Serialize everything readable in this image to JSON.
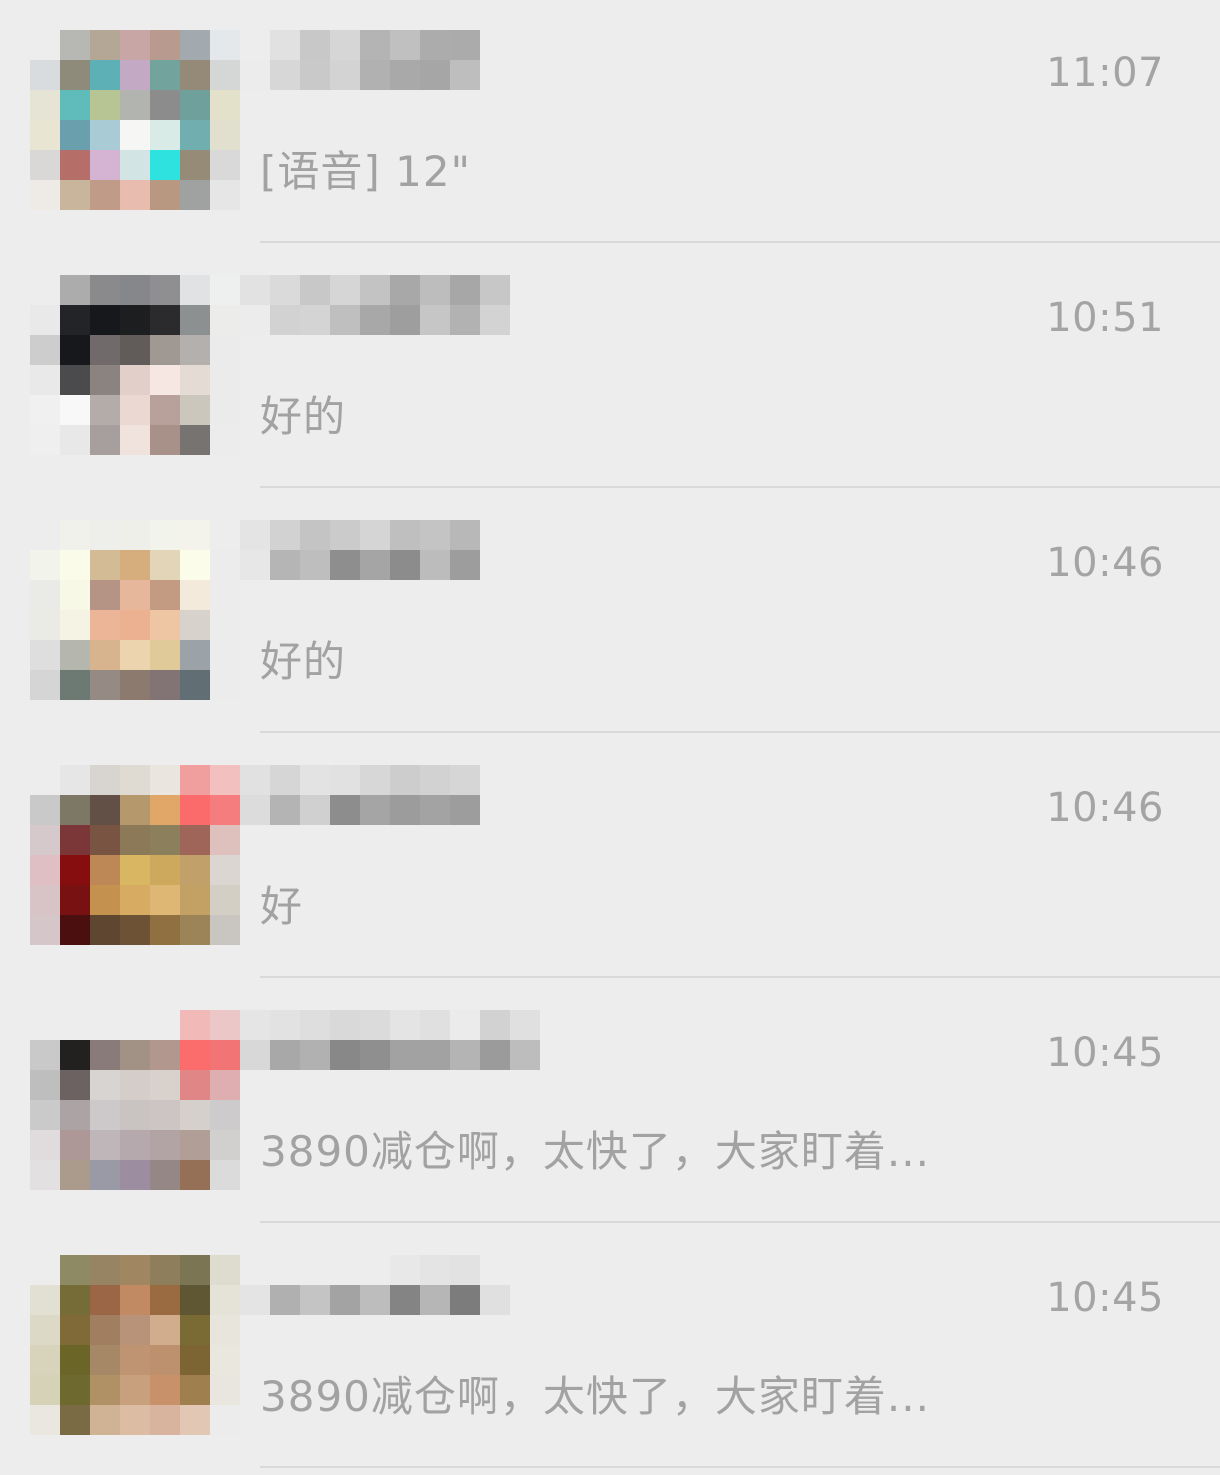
{
  "chats": [
    {
      "time": "11:07",
      "preview": "[语音] 12\"",
      "avatar_pixels": [
        "#ededed",
        "#b7b8b4",
        "#b5a795",
        "#c9a6a6",
        "#b89a8f",
        "#a3aaaf",
        "#e5e8ea",
        "#d9dcde",
        "#8f8b7a",
        "#5eb0b7",
        "#c4a9c5",
        "#72a49d",
        "#948a77",
        "#d5d7d7",
        "#e6e5d5",
        "#60bcbb",
        "#b7c594",
        "#b2b4b0",
        "#8c8c8c",
        "#6fa09b",
        "#e3e1ca",
        "#e8e6d3",
        "#6a9fad",
        "#a9cbd6",
        "#f6f6f4",
        "#d8ebe6",
        "#70aeb0",
        "#e1dfcd",
        "#d9d8d6",
        "#b56f68",
        "#d5b3d3",
        "#d3e4e5",
        "#2ee2e0",
        "#968b77",
        "#d9d9d9",
        "#eeebe6",
        "#c8b59c",
        "#c09b88",
        "#e8bcae",
        "#b89880",
        "#9fa2a1",
        "#e6e6e6"
      ],
      "name_pixels": [
        "#ededed",
        "#ececec",
        "#e1e1e1",
        "#d7d7d7",
        "#c8c8c8",
        "#c9c9c9",
        "#d6d6d6",
        "#d3d3d3",
        "#b4b4b4",
        "#b1b1b1",
        "#c0c0c0",
        "#a9a9a9",
        "#acacac",
        "#a6a6a6",
        "#ababab",
        "#bebebe"
      ]
    },
    {
      "time": "10:51",
      "preview": "好的",
      "avatar_pixels": [
        "#ededed",
        "#acacad",
        "#8a8a8c",
        "#86878a",
        "#8f8f92",
        "#e1e2e3",
        "#eeefef",
        "#e9e9e9",
        "#232427",
        "#16181b",
        "#1d1e20",
        "#2b2b2e",
        "#8d9091",
        "#ececeb",
        "#cdcdcd",
        "#17181b",
        "#706b6a",
        "#615b5a",
        "#a09892",
        "#b3b0ae",
        "#ebebeb",
        "#e9e9e9",
        "#4b4b4e",
        "#8a8380",
        "#e2cfca",
        "#f7e7e2",
        "#e4dcd4",
        "#ebebeb",
        "#f0f0f0",
        "#f8f8f8",
        "#b3aca9",
        "#ecd8d2",
        "#b8a19a",
        "#cbc7bd",
        "#ebebeb",
        "#efefef",
        "#e8e8e8",
        "#a79f9d",
        "#f0e2dd",
        "#a89189",
        "#767370",
        "#ececec"
      ],
      "name_pixels": [
        "#e2e2e2",
        "#ececec",
        "#dadada",
        "#d2d2d2",
        "#c8c8c8",
        "#d4d4d4",
        "#d6d6d6",
        "#bfbfbf",
        "#c3c3c3",
        "#a8a8a8",
        "#a8a8a8",
        "#9e9e9e",
        "#bdbdbd",
        "#c6c6c6",
        "#a7a7a7",
        "#b2b2b2",
        "#c7c7c7",
        "#d3d3d3"
      ]
    },
    {
      "time": "10:46",
      "preview": "好的",
      "avatar_pixels": [
        "#ededed",
        "#f0f1ea",
        "#eeefea",
        "#efefe9",
        "#f2f3ea",
        "#f3f3ec",
        "#ededed",
        "#f2f3ea",
        "#fafbe8",
        "#d2bb95",
        "#d6ad7c",
        "#e3d5b7",
        "#fcfcea",
        "#ececec",
        "#eaeae6",
        "#f7f8e6",
        "#b59385",
        "#e7b79b",
        "#c39b82",
        "#f4eadc",
        "#ececec",
        "#ebebe6",
        "#f5f4e4",
        "#ecb597",
        "#ebb190",
        "#eec6a4",
        "#d8d2cd",
        "#ececec",
        "#dedede",
        "#b5b6ae",
        "#d8b48e",
        "#ecd5ae",
        "#e0ca9a",
        "#9ca3a8",
        "#ececec",
        "#d5d5d5",
        "#6d7a74",
        "#958b84",
        "#8c7a6f",
        "#827374",
        "#616e74",
        "#ececec"
      ],
      "name_pixels": [
        "#e4e4e4",
        "#e7e7e7",
        "#d2d2d2",
        "#b5b5b5",
        "#c4c4c4",
        "#bebebe",
        "#cbcbcb",
        "#8e8e8e",
        "#d5d5d5",
        "#a5a5a5",
        "#bfbfbf",
        "#8c8c8c",
        "#c4c4c4",
        "#bcbcbc",
        "#b8b8b8",
        "#9d9d9d"
      ]
    },
    {
      "time": "10:46",
      "preview": "好",
      "avatar_pixels": [
        "#ededed",
        "#e6e6e6",
        "#d8d4d0",
        "#e0dbd2",
        "#eae5df",
        "#f19e9e",
        "#f3c0c0",
        "#c9c9c9",
        "#7d7866",
        "#624f45",
        "#b5996c",
        "#e1a769",
        "#fb6b6b",
        "#f67d7d",
        "#d5c9cb",
        "#7b3737",
        "#7a5442",
        "#8b7958",
        "#8c7f5b",
        "#a06559",
        "#dec1bc",
        "#dfbfc3",
        "#870e0e",
        "#bd8856",
        "#d9b762",
        "#cda95e",
        "#c1a06a",
        "#dbd6d1",
        "#d8c3c7",
        "#781111",
        "#c5914f",
        "#d7ac62",
        "#dfb774",
        "#c3a064",
        "#d3cfc5",
        "#d4c6c9",
        "#4c0f0f",
        "#5f4631",
        "#6e5236",
        "#906f40",
        "#9d8358",
        "#c9c6c2"
      ],
      "name_pixels": [
        "#e1e1e1",
        "#dcdcdc",
        "#d6d6d6",
        "#b4b4b4",
        "#e3e3e3",
        "#d0d0d0",
        "#e1e1e1",
        "#8d8d8d",
        "#d7d7d7",
        "#a5a5a5",
        "#cdcdcd",
        "#9c9c9c",
        "#d2d2d2",
        "#a3a3a3",
        "#d6d6d6",
        "#9d9d9d"
      ]
    },
    {
      "time": "10:45",
      "preview": "3890减仓啊，太快了，大家盯着...",
      "avatar_pixels": [
        "#ededed",
        "#ededed",
        "#ededed",
        "#ededed",
        "#ededed",
        "#f2b9b9",
        "#ecc7c7",
        "#c9c9c9",
        "#23211f",
        "#887b7a",
        "#a29285",
        "#b2978e",
        "#fb6c6c",
        "#f27474",
        "#bebebe",
        "#6c6262",
        "#d8d4d2",
        "#d5cdca",
        "#d8d1cc",
        "#e08686",
        "#dfaeb0",
        "#cacacb",
        "#aba3a4",
        "#cdc9ca",
        "#c9c4c2",
        "#ccc5c4",
        "#d6d0cd",
        "#cdcbcb",
        "#e0dbdc",
        "#ad9897",
        "#beb6b8",
        "#b6a9ae",
        "#b2a4a5",
        "#b09e97",
        "#d2cfcf",
        "#e2e0e0",
        "#aa9b8d",
        "#9a9aa6",
        "#9c8ea0",
        "#958785",
        "#966f57",
        "#dcdbdb"
      ],
      "name_pixels": [
        "#e5e5e5",
        "#d8d8d8",
        "#e2e2e2",
        "#a8a8a8",
        "#dedede",
        "#b1b1b1",
        "#d9d9d9",
        "#888888",
        "#dbdbdb",
        "#8f8f8f",
        "#e4e4e4",
        "#a2a2a2",
        "#e0e0e0",
        "#a2a2a2",
        "#ebebeb",
        "#b4b4b4",
        "#d2d2d2",
        "#9b9b9b",
        "#e0e0e0",
        "#bdbdbd"
      ]
    },
    {
      "time": "10:45",
      "preview": "3890减仓啊，太快了，大家盯着...",
      "avatar_pixels": [
        "#ededed",
        "#8e8a63",
        "#978462",
        "#a08761",
        "#8e7e5c",
        "#7b7553",
        "#dedccf",
        "#e2e0d2",
        "#756c37",
        "#9a6646",
        "#c28a63",
        "#9a6a41",
        "#5f5734",
        "#e5e3d8",
        "#dcd9c7",
        "#7f6a38",
        "#a27e60",
        "#b99379",
        "#d1ad8e",
        "#7a6a34",
        "#e8e5dc",
        "#d7d4bb",
        "#6b6528",
        "#a78866",
        "#be9473",
        "#bd916d",
        "#7c6533",
        "#e9e7de",
        "#d5d2b7",
        "#6e6a2f",
        "#b09165",
        "#c8a07d",
        "#c9916a",
        "#a07f4e",
        "#e8e6de",
        "#e9e7df",
        "#7b6b45",
        "#cfb394",
        "#dcbca3",
        "#d8b39d",
        "#e2c7b5",
        "#ececec"
      ],
      "name_pixels": [
        "#ededed",
        "#e4e4e4",
        "#ededed",
        "#b0b0b0",
        "#ededed",
        "#c4c4c4",
        "#ededed",
        "#a3a3a3",
        "#ededed",
        "#bdbdbd",
        "#e8e8e8",
        "#848484",
        "#e4e4e4",
        "#b6b6b6",
        "#e2e2e2",
        "#7c7c7c",
        "#ededed",
        "#e0e0e0"
      ]
    }
  ]
}
